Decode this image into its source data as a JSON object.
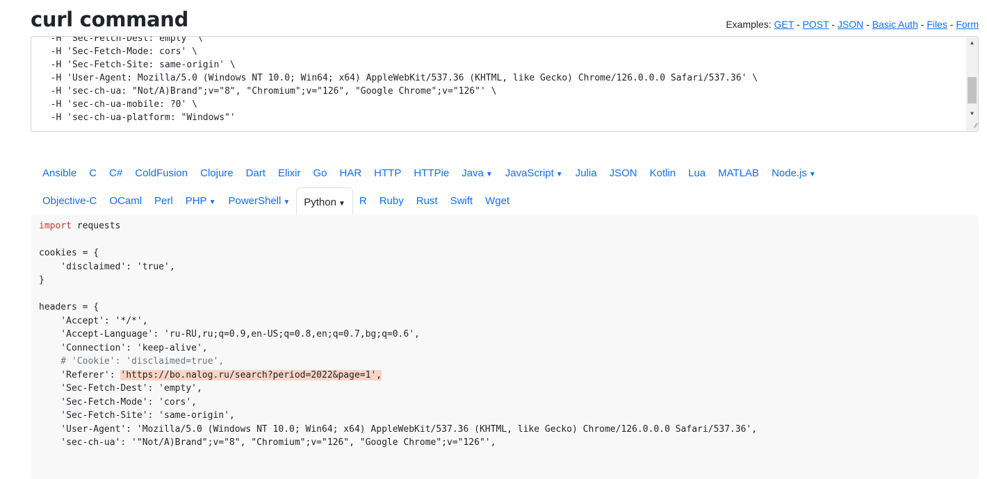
{
  "page": {
    "title": "curl command",
    "examples_label": "Examples:",
    "examples": [
      "GET",
      "POST",
      "JSON",
      "Basic Auth",
      "Files",
      "Form"
    ],
    "examples_separator": " - "
  },
  "curl_input": {
    "lines": [
      "  -H 'Sec-Fetch-Dest: empty' \\",
      "  -H 'Sec-Fetch-Mode: cors' \\",
      "  -H 'Sec-Fetch-Site: same-origin' \\",
      "  -H 'User-Agent: Mozilla/5.0 (Windows NT 10.0; Win64; x64) AppleWebKit/537.36 (KHTML, like Gecko) Chrome/126.0.0.0 Safari/537.36' \\",
      "  -H 'sec-ch-ua: \"Not/A)Brand\";v=\"8\", \"Chromium\";v=\"126\", \"Google Chrome\";v=\"126\"' \\",
      "  -H 'sec-ch-ua-mobile: ?0' \\",
      "  -H 'sec-ch-ua-platform: \"Windows\"'"
    ]
  },
  "languages": {
    "row1": [
      {
        "label": "Ansible",
        "dropdown": false
      },
      {
        "label": "C",
        "dropdown": false
      },
      {
        "label": "C#",
        "dropdown": false
      },
      {
        "label": "ColdFusion",
        "dropdown": false
      },
      {
        "label": "Clojure",
        "dropdown": false
      },
      {
        "label": "Dart",
        "dropdown": false
      },
      {
        "label": "Elixir",
        "dropdown": false
      },
      {
        "label": "Go",
        "dropdown": false
      },
      {
        "label": "HAR",
        "dropdown": false
      },
      {
        "label": "HTTP",
        "dropdown": false
      },
      {
        "label": "HTTPie",
        "dropdown": false
      },
      {
        "label": "Java",
        "dropdown": true
      },
      {
        "label": "JavaScript",
        "dropdown": true
      },
      {
        "label": "Julia",
        "dropdown": false
      },
      {
        "label": "JSON",
        "dropdown": false
      },
      {
        "label": "Kotlin",
        "dropdown": false
      },
      {
        "label": "Lua",
        "dropdown": false
      },
      {
        "label": "MATLAB",
        "dropdown": false
      },
      {
        "label": "Node.js",
        "dropdown": true
      }
    ],
    "row2": [
      {
        "label": "Objective-C",
        "dropdown": false
      },
      {
        "label": "OCaml",
        "dropdown": false
      },
      {
        "label": "Perl",
        "dropdown": false
      },
      {
        "label": "PHP",
        "dropdown": true
      },
      {
        "label": "PowerShell",
        "dropdown": true
      },
      {
        "label": "Python",
        "dropdown": true,
        "active": true
      },
      {
        "label": "R",
        "dropdown": false
      },
      {
        "label": "Ruby",
        "dropdown": false
      },
      {
        "label": "Rust",
        "dropdown": false
      },
      {
        "label": "Swift",
        "dropdown": false
      },
      {
        "label": "Wget",
        "dropdown": false
      }
    ],
    "dropdown_caret": "▼"
  },
  "output_code": {
    "lines": [
      {
        "segments": [
          {
            "t": "import",
            "c": "kw"
          },
          {
            "t": " requests"
          }
        ]
      },
      {
        "segments": [
          {
            "t": ""
          }
        ]
      },
      {
        "segments": [
          {
            "t": "cookies = {"
          }
        ]
      },
      {
        "segments": [
          {
            "t": "    'disclaimed': 'true',"
          }
        ]
      },
      {
        "segments": [
          {
            "t": "}"
          }
        ]
      },
      {
        "segments": [
          {
            "t": ""
          }
        ]
      },
      {
        "segments": [
          {
            "t": "headers = {"
          }
        ]
      },
      {
        "segments": [
          {
            "t": "    'Accept': '*/*',"
          }
        ]
      },
      {
        "segments": [
          {
            "t": "    'Accept-Language': 'ru-RU,ru;q=0.9,en-US;q=0.8,en;q=0.7,bg;q=0.6',"
          }
        ]
      },
      {
        "segments": [
          {
            "t": "    'Connection': 'keep-alive',"
          }
        ]
      },
      {
        "segments": [
          {
            "t": "    # 'Cookie': 'disclaimed=true',",
            "c": "cm"
          }
        ]
      },
      {
        "segments": [
          {
            "t": "    'Referer': "
          },
          {
            "t": "'https://bo.nalog.ru/search?period=2022&page=1',",
            "c": "hl"
          }
        ]
      },
      {
        "segments": [
          {
            "t": "    'Sec-Fetch-Dest': 'empty',"
          }
        ]
      },
      {
        "segments": [
          {
            "t": "    'Sec-Fetch-Mode': 'cors',"
          }
        ]
      },
      {
        "segments": [
          {
            "t": "    'Sec-Fetch-Site': 'same-origin',"
          }
        ]
      },
      {
        "segments": [
          {
            "t": "    'User-Agent': 'Mozilla/5.0 (Windows NT 10.0; Win64; x64) AppleWebKit/537.36 (KHTML, like Gecko) Chrome/126.0.0.0 Safari/537.36',"
          }
        ]
      },
      {
        "segments": [
          {
            "t": "    'sec-ch-ua': '\"Not/A)Brand\";v=\"8\", \"Chromium\";v=\"126\", \"Google Chrome\";v=\"126\"',"
          }
        ]
      }
    ]
  },
  "icons": {
    "scroll_up": "▲",
    "scroll_down": "▼",
    "resize": "⁄⁄"
  }
}
